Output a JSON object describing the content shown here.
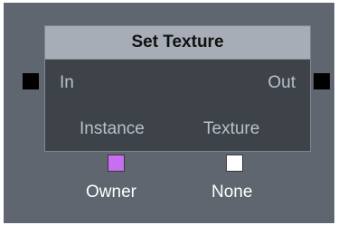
{
  "node": {
    "title": "Set Texture",
    "exec_in_label": "In",
    "exec_out_label": "Out",
    "inputs": [
      {
        "label": "Instance",
        "value": "Owner",
        "color": "#c86ef0"
      },
      {
        "label": "Texture",
        "value": "None",
        "color": "#ffffff"
      }
    ]
  },
  "colors": {
    "canvas": "#5f6670",
    "node_body": "#3e434a",
    "node_header": "#a6adb7",
    "label_text": "#b9c0ca",
    "exec_pin": "#000000"
  }
}
